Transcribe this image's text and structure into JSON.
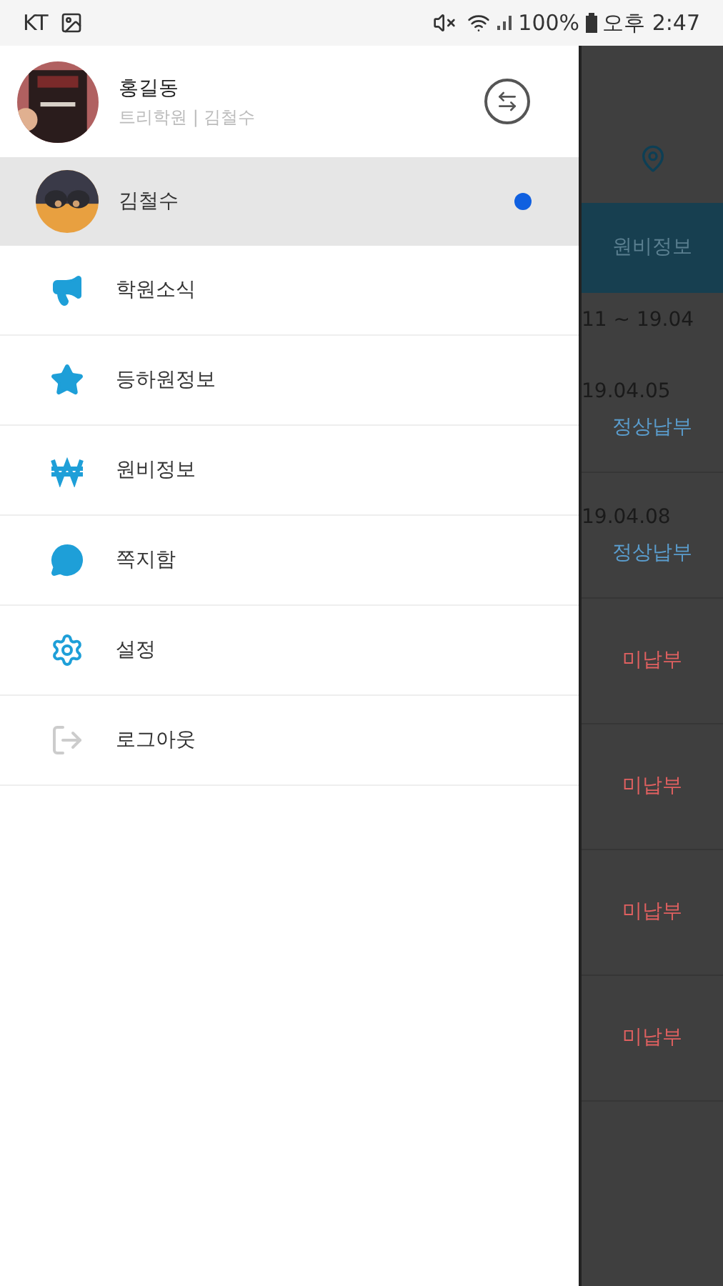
{
  "status_bar": {
    "carrier": "KT",
    "battery": "100%",
    "time": "오후 2:47"
  },
  "drawer": {
    "profile": {
      "name": "홍길동",
      "subtitle": "트리학원 | 김철수"
    },
    "children": [
      {
        "name": "김철수",
        "selected": true
      }
    ],
    "menu": [
      {
        "label": "학원소식",
        "kind": "megaphone"
      },
      {
        "label": "등하원정보",
        "kind": "star"
      },
      {
        "label": "원비정보",
        "kind": "won"
      },
      {
        "label": "쪽지함",
        "kind": "chat"
      },
      {
        "label": "설정",
        "kind": "gear"
      },
      {
        "label": "로그아웃",
        "kind": "logout"
      }
    ]
  },
  "background": {
    "tab_label": "원비정보",
    "period": "11 ~ 19.04",
    "rows": [
      {
        "date": "19.04.05",
        "status": "정상납부",
        "kind": "paid"
      },
      {
        "date": "19.04.08",
        "status": "정상납부",
        "kind": "paid"
      },
      {
        "status": "미납부",
        "kind": "unpaid"
      },
      {
        "status": "미납부",
        "kind": "unpaid"
      },
      {
        "status": "미납부",
        "kind": "unpaid"
      },
      {
        "status": "미납부",
        "kind": "unpaid"
      }
    ]
  }
}
